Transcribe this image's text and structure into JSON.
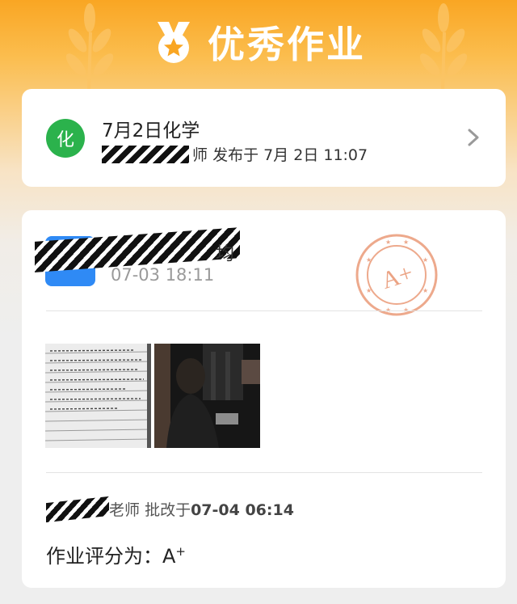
{
  "header": {
    "title": "优秀作业",
    "medal_icon": "medal-star-icon"
  },
  "assignment": {
    "subject_badge": "化",
    "subject_color": "#2bb24c",
    "title": "7月2日化学",
    "publisher_suffix": "师",
    "publish_text": "发布于 7月 2日 11:07"
  },
  "submission": {
    "name_suffix": "均",
    "time": "07-03 18:11",
    "stamp_text": "A+",
    "stamp_color": "#e8936f"
  },
  "review": {
    "grader_suffix": "老师",
    "graded_prefix": "批改于",
    "graded_time": "07-04 06:14",
    "score_label": "作业评分为：",
    "score_letter": "A",
    "score_plus": "+"
  },
  "colors": {
    "accent": "#f9a623",
    "avatar_blue": "#2f8af5"
  }
}
